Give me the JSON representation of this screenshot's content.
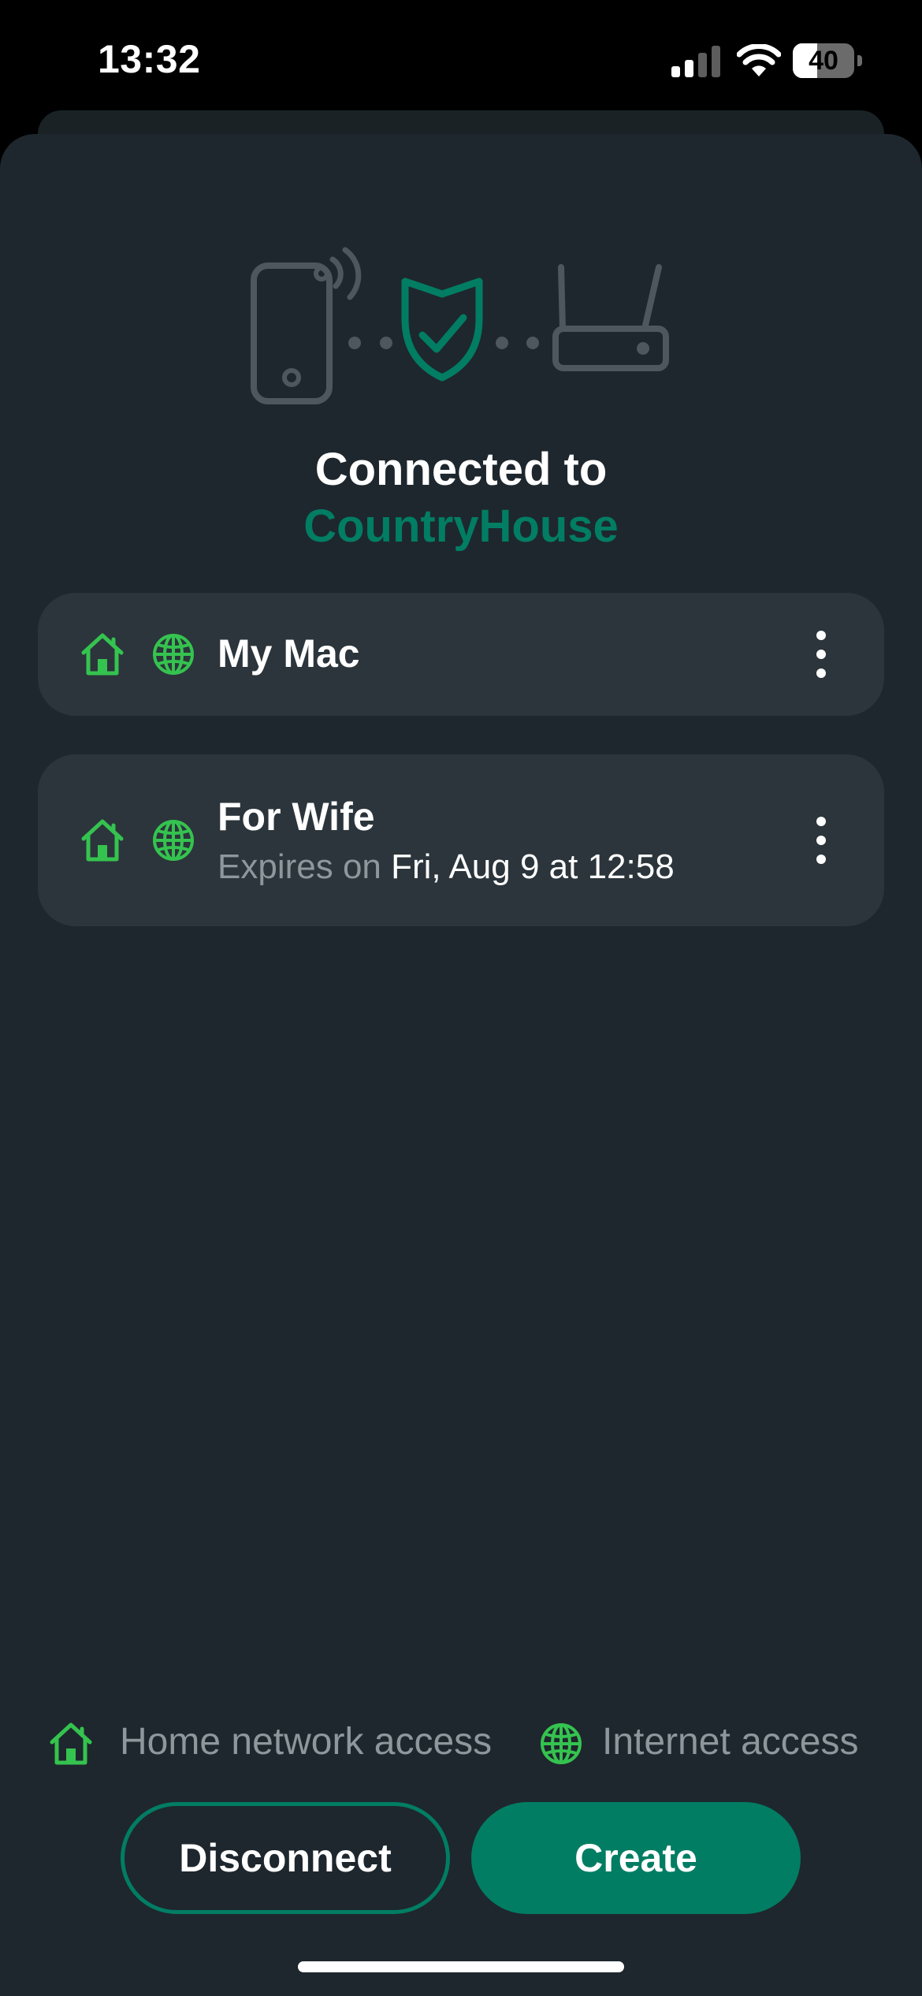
{
  "status_bar": {
    "time": "13:32",
    "battery_level": "40",
    "battery_fraction": 0.4,
    "signal_bars_active": 2,
    "signal_bars_total": 4
  },
  "header": {
    "title": "Connected to",
    "network_name": "CountryHouse"
  },
  "devices": [
    {
      "name": "My Mac",
      "home_access_icon": "home-icon",
      "internet_access_icon": "globe-icon",
      "menu_icon": "more-vertical-icon"
    },
    {
      "name": "For Wife",
      "expiry_label": "Expires on",
      "expiry_date": "Fri, Aug 9 at 12:58",
      "home_access_icon": "home-icon",
      "internet_access_icon": "globe-icon",
      "menu_icon": "more-vertical-icon"
    }
  ],
  "legend": {
    "home": "Home network access",
    "internet": "Internet access"
  },
  "actions": {
    "disconnect": "Disconnect",
    "create": "Create"
  },
  "colors": {
    "accent": "#017d63",
    "icon_green": "#35c34f",
    "background": "#1e272d",
    "card": "#2b353b",
    "muted_text": "#8e979c",
    "illustration_gray": "#4e575d"
  }
}
